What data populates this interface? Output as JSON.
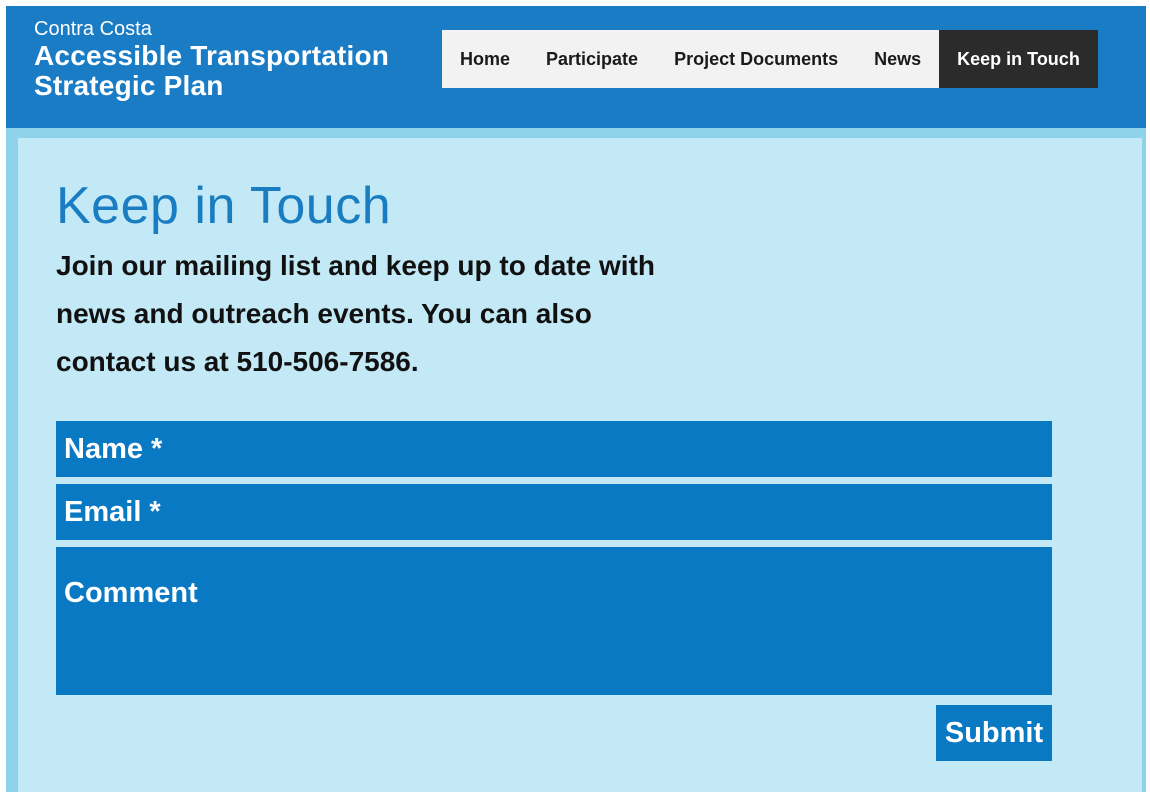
{
  "header": {
    "brand_sub": "Contra Costa",
    "brand_title_line1": "Accessible Transportation",
    "brand_title_line2": "Strategic Plan"
  },
  "nav": {
    "items": [
      {
        "label": "Home",
        "active": false
      },
      {
        "label": "Participate",
        "active": false
      },
      {
        "label": "Project Documents",
        "active": false
      },
      {
        "label": "News",
        "active": false
      },
      {
        "label": "Keep in Touch",
        "active": true
      }
    ]
  },
  "main": {
    "title": "Keep in Touch",
    "intro": "Join our mailing list and keep up to date with news and outreach events. You can also contact us at 510-506-7586."
  },
  "form": {
    "name_placeholder": "Name *",
    "email_placeholder": "Email *",
    "comment_placeholder": "Comment",
    "submit_label": "Submit"
  },
  "colors": {
    "header_blue": "#1a7cc4",
    "field_blue": "#0a79c3",
    "content_bg": "#c2e9f5",
    "active_nav": "#2b2b2b"
  }
}
